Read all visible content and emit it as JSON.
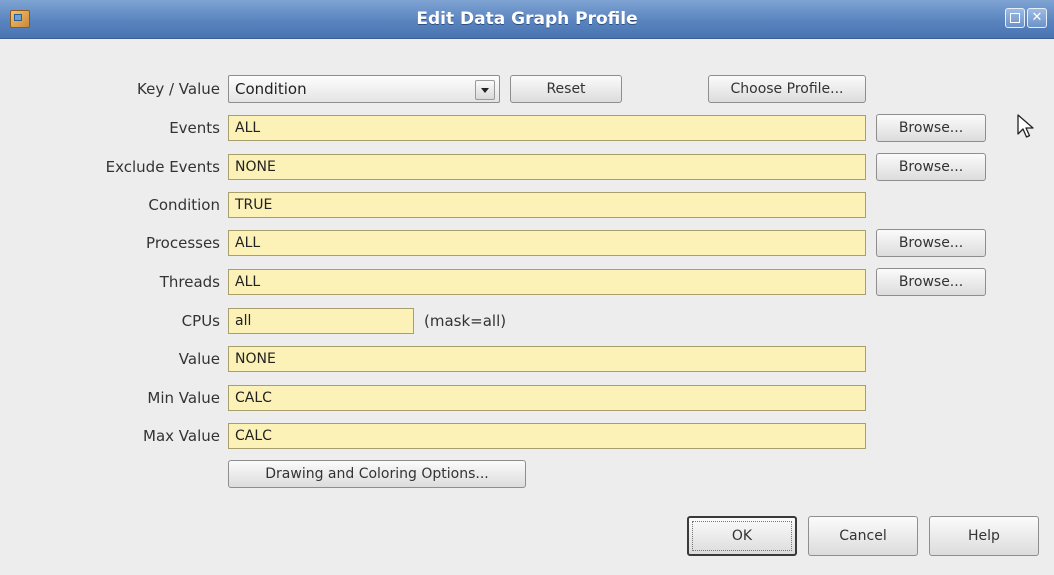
{
  "window": {
    "title": "Edit Data Graph Profile"
  },
  "form": {
    "key_value": {
      "label": "Key / Value",
      "selected": "Condition"
    },
    "reset_label": "Reset",
    "choose_profile_label": "Choose Profile...",
    "events": {
      "label": "Events",
      "value": "ALL",
      "browse": "Browse..."
    },
    "exclude_events": {
      "label": "Exclude Events",
      "value": "NONE",
      "browse": "Browse..."
    },
    "condition": {
      "label": "Condition",
      "value": "TRUE"
    },
    "processes": {
      "label": "Processes",
      "value": "ALL",
      "browse": "Browse..."
    },
    "threads": {
      "label": "Threads",
      "value": "ALL",
      "browse": "Browse..."
    },
    "cpus": {
      "label": "CPUs",
      "value": "all",
      "mask_note": "(mask=all)"
    },
    "value": {
      "label": "Value",
      "value": "NONE"
    },
    "min_value": {
      "label": "Min Value",
      "value": "CALC"
    },
    "max_value": {
      "label": "Max Value",
      "value": "CALC"
    },
    "drawing_options_label": "Drawing and Coloring Options..."
  },
  "footer": {
    "ok_label": "OK",
    "cancel_label": "Cancel",
    "help_label": "Help"
  },
  "colors": {
    "titlebar": "#5a84bf",
    "field_background": "#fcf2b7",
    "dialog_background": "#ededed"
  },
  "icons": [
    "app-icon",
    "maximize-icon",
    "close-icon",
    "mouse-pointer-icon",
    "dropdown-arrow-icon"
  ]
}
